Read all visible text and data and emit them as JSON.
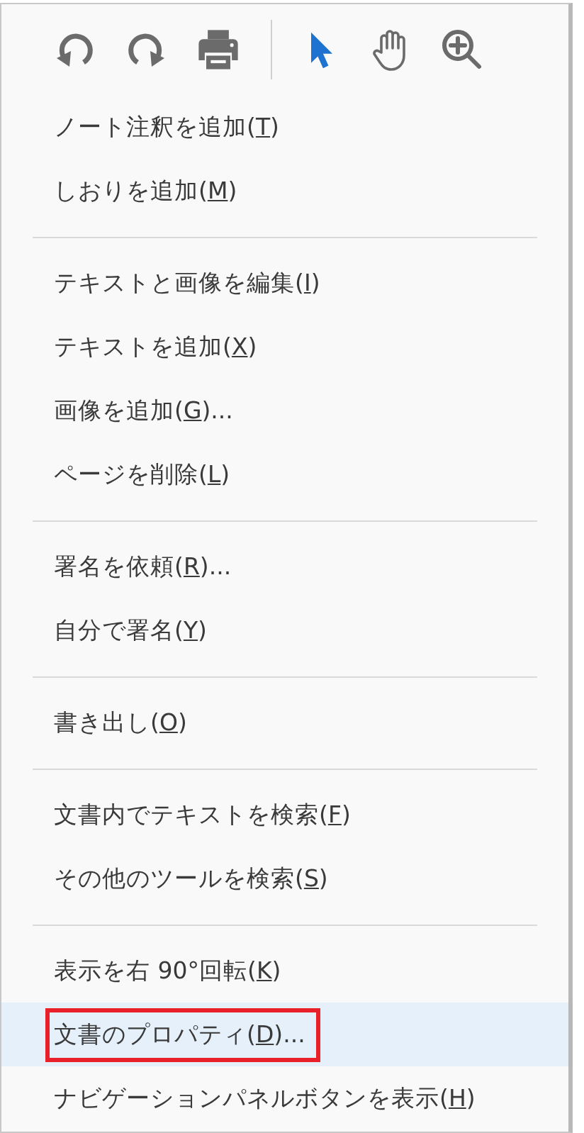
{
  "toolbar": {
    "groups": [
      {
        "tools": [
          {
            "kind": "undo",
            "selected": false
          },
          {
            "kind": "redo",
            "selected": false
          },
          {
            "kind": "print",
            "selected": false
          }
        ]
      },
      {
        "tools": [
          {
            "kind": "select",
            "selected": true
          },
          {
            "kind": "hand",
            "selected": false
          },
          {
            "kind": "zoom",
            "selected": false
          }
        ]
      }
    ]
  },
  "menu": {
    "groups": [
      {
        "items": [
          {
            "label": "ノート注釈を追加(",
            "mnemonic": "T",
            "after": ")",
            "selected": false,
            "outlined": false
          },
          {
            "label": "しおりを追加(",
            "mnemonic": "M",
            "after": ")",
            "selected": false,
            "outlined": false
          }
        ]
      },
      {
        "items": [
          {
            "label": "テキストと画像を編集(",
            "mnemonic": "I",
            "after": ")",
            "selected": false,
            "outlined": false
          },
          {
            "label": "テキストを追加(",
            "mnemonic": "X",
            "after": ")",
            "selected": false,
            "outlined": false
          },
          {
            "label": "画像を追加(",
            "mnemonic": "G",
            "after": ")...",
            "selected": false,
            "outlined": false
          },
          {
            "label": "ページを削除(",
            "mnemonic": "L",
            "after": ")",
            "selected": false,
            "outlined": false
          }
        ]
      },
      {
        "items": [
          {
            "label": "署名を依頼(",
            "mnemonic": "R",
            "after": ")...",
            "selected": false,
            "outlined": false
          },
          {
            "label": "自分で署名(",
            "mnemonic": "Y",
            "after": ")",
            "selected": false,
            "outlined": false
          }
        ]
      },
      {
        "items": [
          {
            "label": "書き出し(",
            "mnemonic": "O",
            "after": ")",
            "selected": false,
            "outlined": false
          }
        ]
      },
      {
        "items": [
          {
            "label": "文書内でテキストを検索(",
            "mnemonic": "F",
            "after": ")",
            "selected": false,
            "outlined": false
          },
          {
            "label": "その他のツールを検索(",
            "mnemonic": "S",
            "after": ")",
            "selected": false,
            "outlined": false
          }
        ]
      },
      {
        "items": [
          {
            "label": "表示を右 90°回転(",
            "mnemonic": "K",
            "after": ")",
            "selected": false,
            "outlined": false
          },
          {
            "label": "文書のプロパティ(",
            "mnemonic": "D",
            "after": ")...",
            "selected": true,
            "outlined": true
          },
          {
            "label": "ナビゲーションパネルボタンを表示(",
            "mnemonic": "H",
            "after": ")",
            "selected": false,
            "outlined": false
          }
        ]
      }
    ]
  }
}
